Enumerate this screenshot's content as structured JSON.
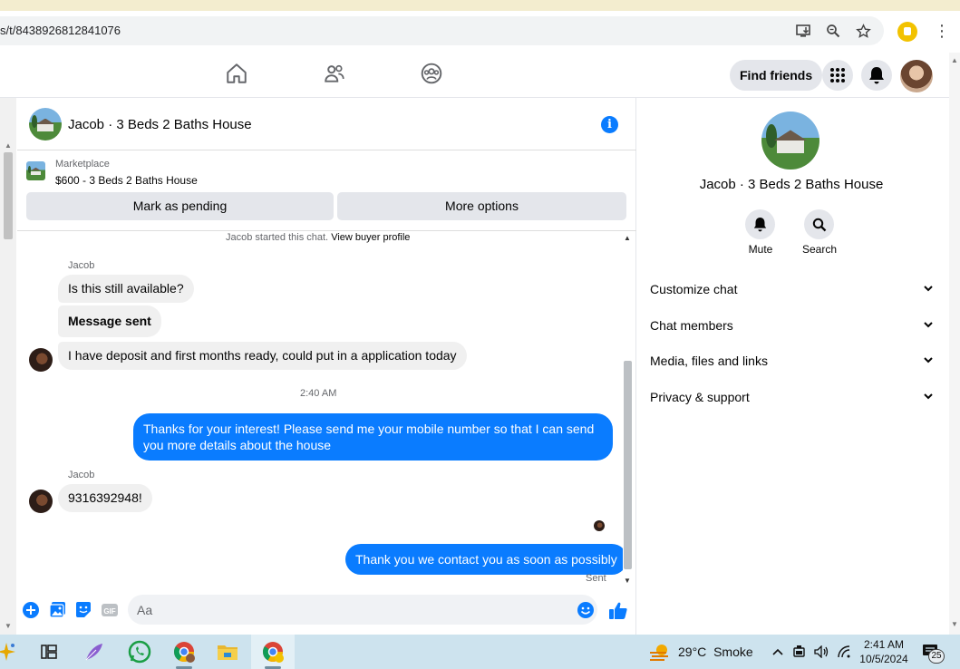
{
  "browser": {
    "url": "s/t/8438926812841076"
  },
  "header": {
    "find_friends": "Find friends"
  },
  "chat": {
    "title": "Jacob · 3 Beds 2 Baths House",
    "marketplace_label": "Marketplace",
    "listing": "$600 - 3 Beds 2 Baths House",
    "mark_pending": "Mark as pending",
    "more_options": "More options",
    "started_text": "Jacob started this chat.",
    "view_buyer_profile": "View buyer profile",
    "messages": [
      {
        "sender": "Jacob",
        "text": "Is this still available?"
      },
      {
        "text": "Message sent"
      },
      {
        "text": "I have deposit and first months ready, could put in a application today"
      },
      {
        "timestamp": "2:40 AM"
      },
      {
        "text": "Thanks for your interest! Please send me your mobile number so that I can send you more details about the house"
      },
      {
        "sender": "Jacob",
        "text": "9316392948!"
      },
      {
        "text": "Thank you we contact you as soon as possibly"
      }
    ],
    "sent_status": "Sent",
    "composer_placeholder": "Aa"
  },
  "sidebar": {
    "title": "Jacob · 3 Beds 2 Baths House",
    "mute_label": "Mute",
    "search_label": "Search",
    "sections": [
      "Customize chat",
      "Chat members",
      "Media, files and links",
      "Privacy & support"
    ]
  },
  "taskbar": {
    "temperature": "29°C",
    "weather": "Smoke",
    "time": "2:41 AM",
    "date": "10/5/2024",
    "notification_count": "25"
  },
  "colors": {
    "messenger_blue": "#0a7cff",
    "bubble_gray": "#f0f0f0",
    "taskbar": "#cde3ee"
  }
}
